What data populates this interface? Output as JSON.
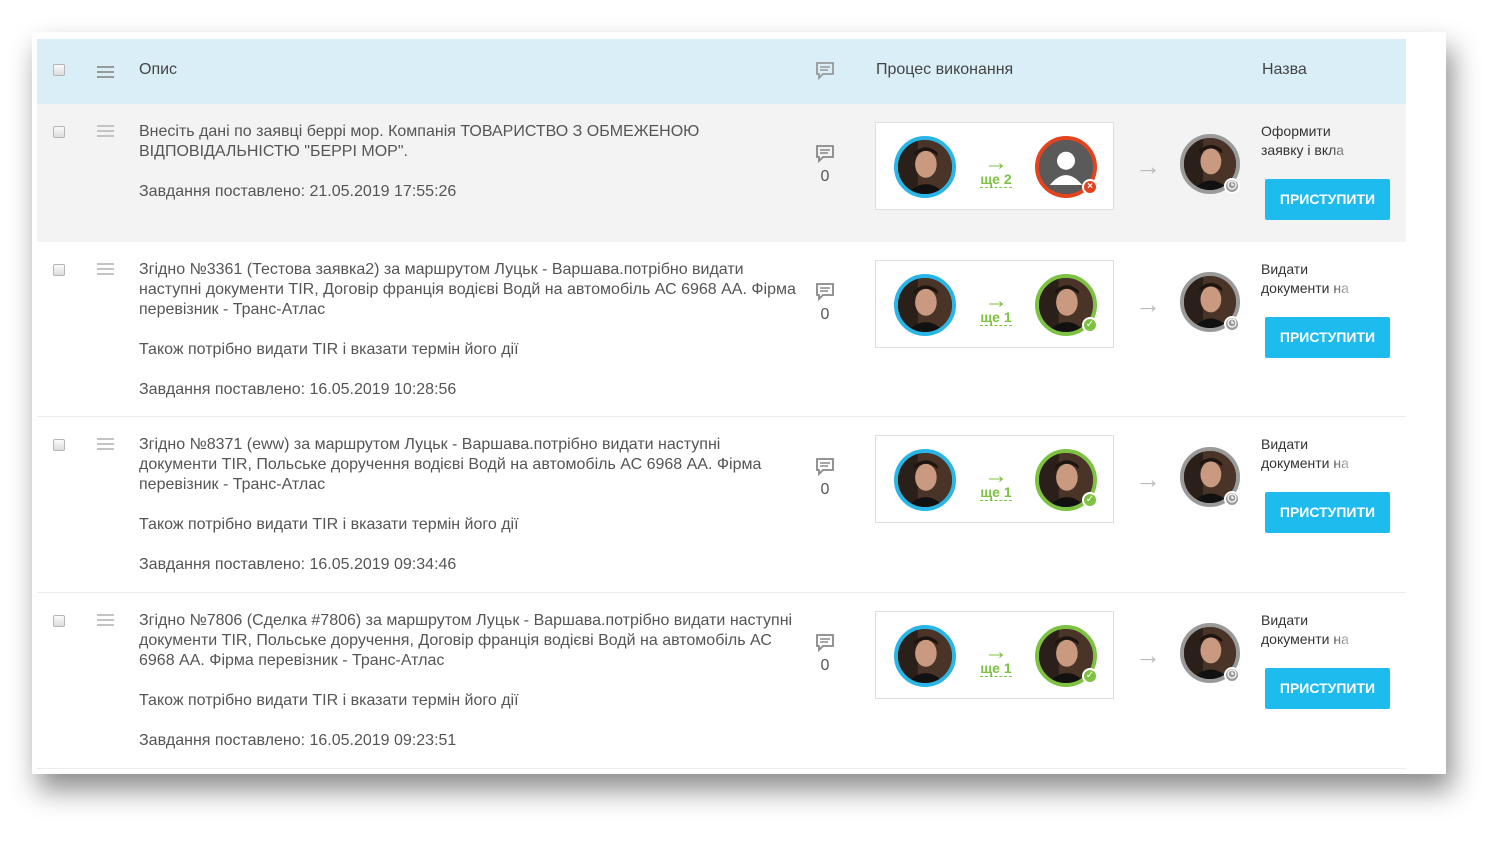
{
  "header": {
    "description": "Опис",
    "process": "Процес виконання",
    "name": "Назва"
  },
  "icons": {
    "comments": "comment-icon",
    "drag": "drag-handle-icon",
    "clock": "clock-icon",
    "check": "check-icon",
    "reject": "close-icon"
  },
  "colors": {
    "header_bg": "#daeef8",
    "accent": "#1ebbee",
    "green": "#7dc242",
    "red": "#e3431f"
  },
  "rows": [
    {
      "paragraphs": [
        "Внесіть дані по заявці беррі мор. Компанія ТОВАРИСТВО З ОБМЕЖЕНОЮ ВІДПОВІДАЛЬНІСТЮ \"БЕРРІ МОР\"."
      ],
      "created": "Завдання поставлено: 21.05.2019 17:55:26",
      "comments": "0",
      "more": "ще 2",
      "status": "rejected",
      "name_line1": "Оформити",
      "name_line2": "заявку і вкла",
      "action": "ПРИСТУПИТИ"
    },
    {
      "paragraphs": [
        "Згідно №3361 (Тестова заявка2) за маршрутом Луцьк - Варшава.потрібно видати наступні документи TIR, Договір франція водієві Водй на автомобіль АС 6968 АА. Фірма перевізник - Транс-Атлас",
        "Також потрібно видати TIR і вказати термін його дії"
      ],
      "created": "Завдання поставлено: 16.05.2019 10:28:56",
      "comments": "0",
      "more": "ще 1",
      "status": "approved",
      "name_line1": "Видати",
      "name_line2": "документи на",
      "action": "ПРИСТУПИТИ"
    },
    {
      "paragraphs": [
        "Згідно №8371 (eww) за маршрутом Луцьк - Варшава.потрібно видати наступні документи TIR, Польське доручення водієві Водй на автомобіль АС 6968 АА. Фірма перевізник - Транс-Атлас",
        "Також потрібно видати TIR і вказати термін його дії"
      ],
      "created": "Завдання поставлено: 16.05.2019 09:34:46",
      "comments": "0",
      "more": "ще 1",
      "status": "approved",
      "name_line1": "Видати",
      "name_line2": "документи на",
      "action": "ПРИСТУПИТИ"
    },
    {
      "paragraphs": [
        "Згідно №7806 (Сделка #7806) за маршрутом Луцьк - Варшава.потрібно видати наступні документи TIR, Польське доручення, Договір франція водієві Водй на автомобіль АС 6968 АА. Фірма перевізник - Транс-Атлас",
        "Також потрібно видати TIR і вказати термін його дії"
      ],
      "created": "Завдання поставлено: 16.05.2019 09:23:51",
      "comments": "0",
      "more": "ще 1",
      "status": "approved",
      "name_line1": "Видати",
      "name_line2": "документи на",
      "action": "ПРИСТУПИТИ"
    }
  ]
}
